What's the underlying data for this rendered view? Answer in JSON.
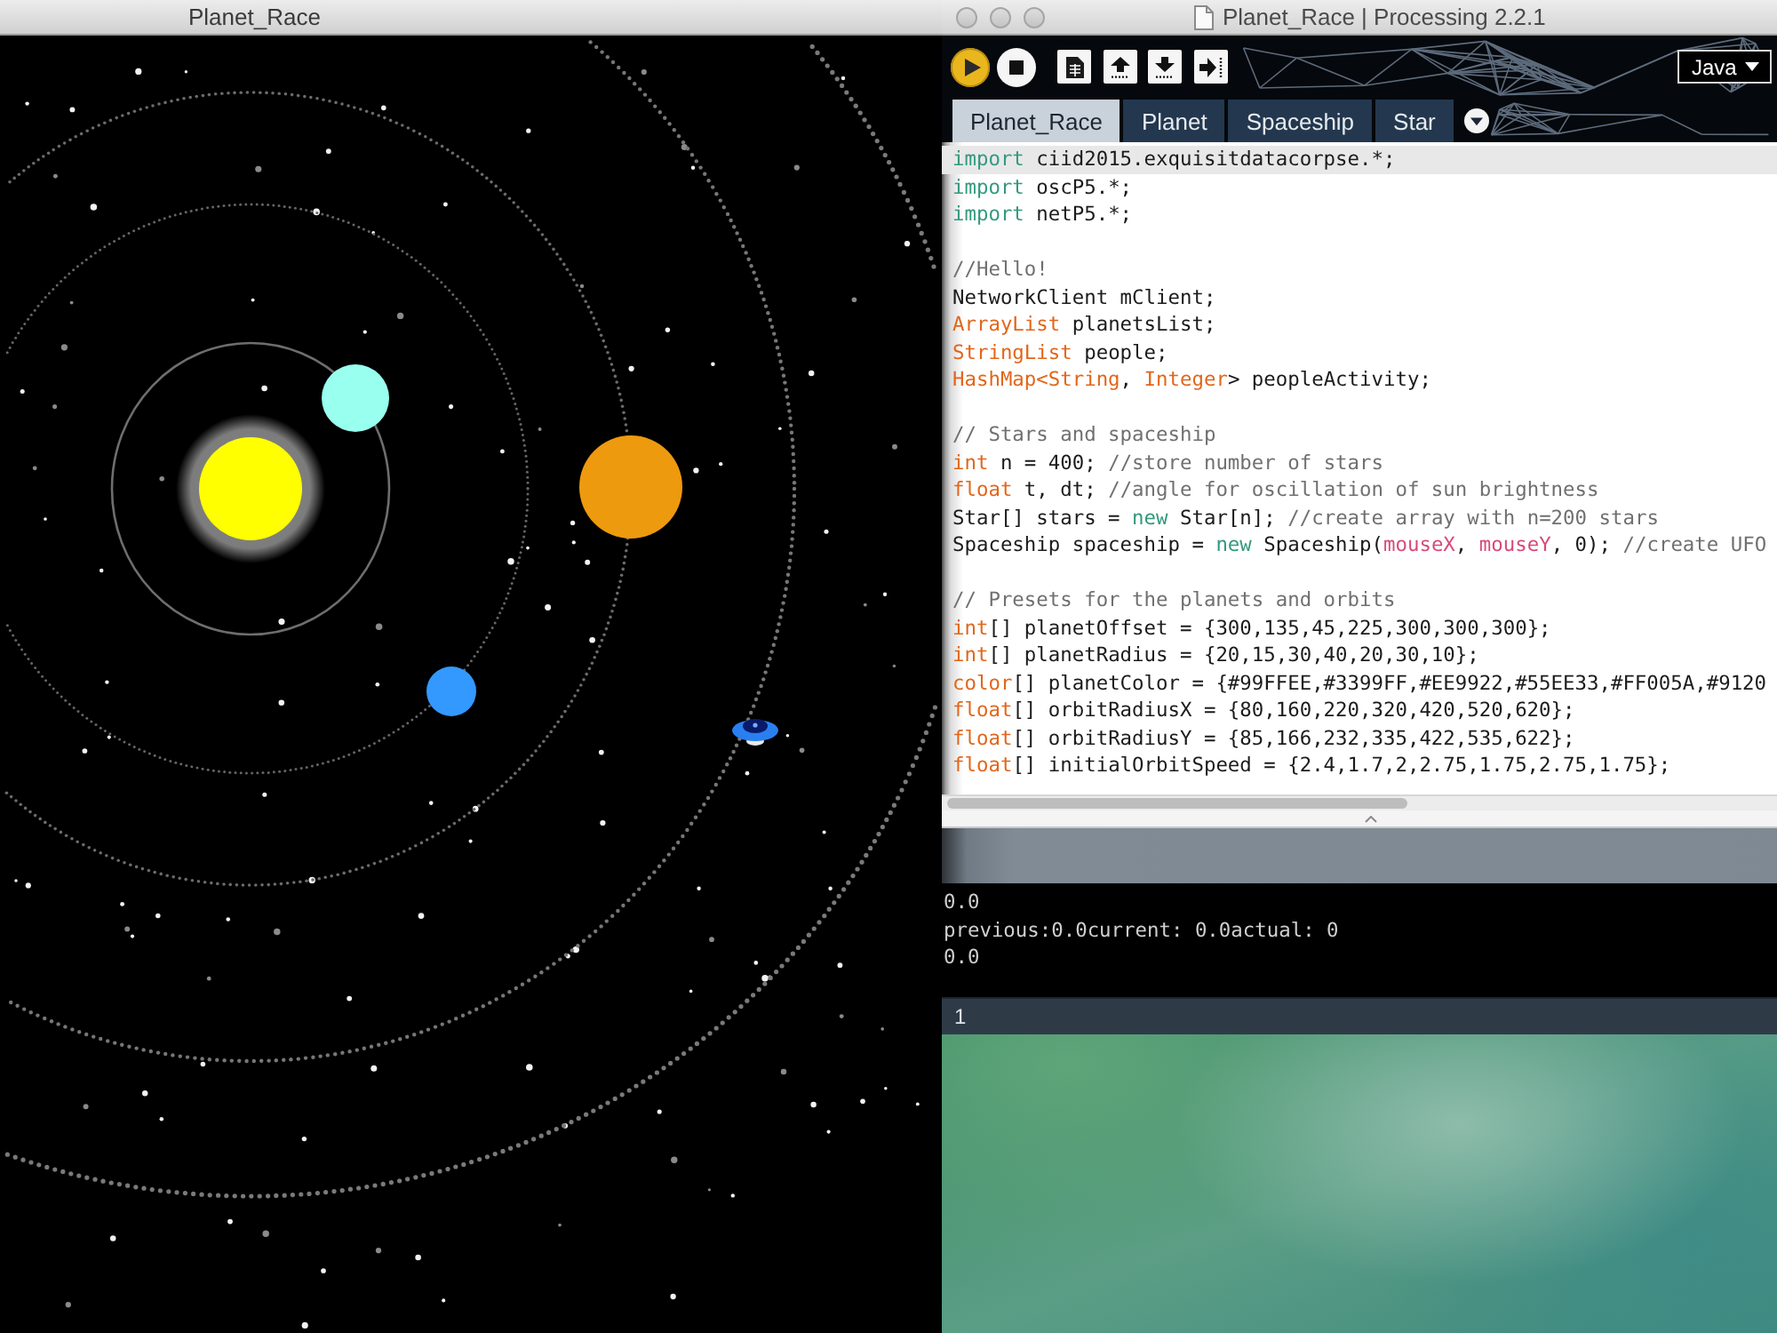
{
  "sketch_window": {
    "title": "Planet_Race"
  },
  "ide_window": {
    "title": "Planet_Race | Processing 2.2.1",
    "toolbar": {
      "buttons": [
        {
          "kind": "run",
          "highlighted": true
        },
        {
          "kind": "stop",
          "highlighted": false
        },
        {
          "kind": "new",
          "highlighted": false
        },
        {
          "kind": "open",
          "highlighted": false
        },
        {
          "kind": "save",
          "highlighted": false
        },
        {
          "kind": "export",
          "highlighted": false
        }
      ],
      "mode": "Java"
    },
    "tabs": [
      {
        "label": "Planet_Race",
        "selected": true
      },
      {
        "label": "Planet",
        "selected": false
      },
      {
        "label": "Spaceship",
        "selected": false
      },
      {
        "label": "Star",
        "selected": false
      }
    ],
    "editor": {
      "blocks": [
        [
          {
            "current": true,
            "tokens": [
              {
                "kind": "keyword",
                "text": "import"
              },
              {
                "kind": "plain",
                "text": " ciid2015.exquisitdatacorpse.*;"
              }
            ]
          },
          {
            "current": false,
            "tokens": [
              {
                "kind": "keyword",
                "text": "import"
              },
              {
                "kind": "plain",
                "text": " oscP5.*;"
              }
            ]
          },
          {
            "current": false,
            "tokens": [
              {
                "kind": "keyword",
                "text": "import"
              },
              {
                "kind": "plain",
                "text": " netP5.*;"
              }
            ]
          }
        ],
        [
          {
            "current": false,
            "tokens": [
              {
                "kind": "comment",
                "text": "//Hello!"
              }
            ]
          },
          {
            "current": false,
            "tokens": [
              {
                "kind": "plain",
                "text": "NetworkClient mClient;"
              }
            ]
          },
          {
            "current": false,
            "tokens": [
              {
                "kind": "type",
                "text": "ArrayList"
              },
              {
                "kind": "plain",
                "text": " planetsList;"
              }
            ]
          },
          {
            "current": false,
            "tokens": [
              {
                "kind": "type",
                "text": "StringList"
              },
              {
                "kind": "plain",
                "text": " people;"
              }
            ]
          },
          {
            "current": false,
            "tokens": [
              {
                "kind": "type",
                "text": "HashMap<String"
              },
              {
                "kind": "plain",
                "text": ", "
              },
              {
                "kind": "type",
                "text": "Integer"
              },
              {
                "kind": "plain",
                "text": "> peopleActivity;"
              }
            ]
          }
        ],
        [
          {
            "current": false,
            "tokens": [
              {
                "kind": "comment",
                "text": "// Stars and spaceship"
              }
            ]
          },
          {
            "current": false,
            "tokens": [
              {
                "kind": "type",
                "text": "int"
              },
              {
                "kind": "plain",
                "text": " n = 400; "
              },
              {
                "kind": "comment",
                "text": "//store number of stars"
              }
            ]
          },
          {
            "current": false,
            "tokens": [
              {
                "kind": "type",
                "text": "float"
              },
              {
                "kind": "plain",
                "text": " t, dt; "
              },
              {
                "kind": "comment",
                "text": "//angle for oscillation of sun brightness"
              }
            ]
          },
          {
            "current": false,
            "tokens": [
              {
                "kind": "plain",
                "text": "Star[] stars = "
              },
              {
                "kind": "keyword",
                "text": "new"
              },
              {
                "kind": "plain",
                "text": " Star[n]; "
              },
              {
                "kind": "comment",
                "text": "//create array with n=200 stars"
              }
            ]
          },
          {
            "current": false,
            "tokens": [
              {
                "kind": "plain",
                "text": "Spaceship spaceship = "
              },
              {
                "kind": "keyword",
                "text": "new"
              },
              {
                "kind": "plain",
                "text": " Spaceship("
              },
              {
                "kind": "variable",
                "text": "mouseX"
              },
              {
                "kind": "plain",
                "text": ", "
              },
              {
                "kind": "variable",
                "text": "mouseY"
              },
              {
                "kind": "plain",
                "text": ", 0); "
              },
              {
                "kind": "comment",
                "text": "//create UFO"
              }
            ]
          }
        ],
        [
          {
            "current": false,
            "tokens": [
              {
                "kind": "comment",
                "text": "// Presets for the planets and orbits"
              }
            ]
          },
          {
            "current": false,
            "tokens": [
              {
                "kind": "type",
                "text": "int"
              },
              {
                "kind": "plain",
                "text": "[] planetOffset = {300,135,45,225,300,300,300};"
              }
            ]
          },
          {
            "current": false,
            "tokens": [
              {
                "kind": "type",
                "text": "int"
              },
              {
                "kind": "plain",
                "text": "[] planetRadius = {20,15,30,40,20,30,10};"
              }
            ]
          },
          {
            "current": false,
            "tokens": [
              {
                "kind": "type",
                "text": "color"
              },
              {
                "kind": "plain",
                "text": "[] planetColor = {#99FFEE,#3399FF,#EE9922,#55EE33,#FF005A,#9120"
              }
            ]
          },
          {
            "current": false,
            "tokens": [
              {
                "kind": "type",
                "text": "float"
              },
              {
                "kind": "plain",
                "text": "[] orbitRadiusX = {80,160,220,320,420,520,620};"
              }
            ]
          },
          {
            "current": false,
            "tokens": [
              {
                "kind": "type",
                "text": "float"
              },
              {
                "kind": "plain",
                "text": "[] orbitRadiusY = {85,166,232,335,422,535,622};"
              }
            ]
          },
          {
            "current": false,
            "tokens": [
              {
                "kind": "type",
                "text": "float"
              },
              {
                "kind": "plain",
                "text": "[] initialOrbitSpeed = {2.4,1.7,2,2.75,1.75,2.75,1.75};"
              }
            ]
          }
        ]
      ]
    },
    "console": {
      "lines": [
        "0.0",
        "previous:0.0current: 0.0actual: 0",
        "0.0"
      ]
    },
    "status_bar": {
      "line_number": "1"
    }
  }
}
